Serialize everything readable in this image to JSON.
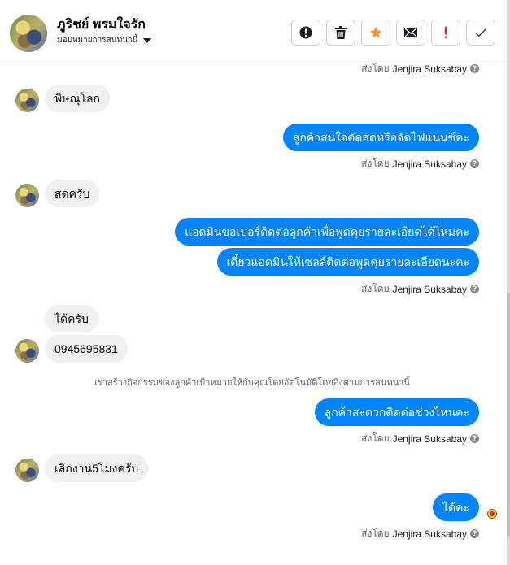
{
  "header": {
    "name": "ภูริชย์ พรมใจรัก",
    "assign_label": "มอบหมายการสนทนานี้",
    "actions": [
      {
        "icon": "alert-circle-icon",
        "color": "#1c1e21"
      },
      {
        "icon": "trash-icon",
        "color": "#1c1e21"
      },
      {
        "icon": "star-icon",
        "color": "#f7923a"
      },
      {
        "icon": "envelope-icon",
        "color": "#1c1e21"
      },
      {
        "icon": "exclamation-icon",
        "color": "#e02424"
      },
      {
        "icon": "check-icon",
        "color": "#4b4f56"
      }
    ]
  },
  "messages": {
    "sent_by_prefix": "ส่งโดย",
    "sent_by_name": "Jenjira Suksabay",
    "m1": "พิษณุโลก",
    "m2": "ลูกค้าสนใจตัดสดหรือจัดไฟแนนซ์คะ",
    "m3": "สดครับ",
    "m4": "แอดมินขอเบอร์ติดต่อลูกค้าเพื่อพูดคุยรายละเอียดได้ไหมคะ",
    "m5": "เดี๋ยวแอดมินให้เซลล์ติดต่อพูดคุยรายละเอียดนะคะ",
    "m6": "ได้ครับ",
    "m7": "0945695831",
    "system": "เราสร้างกิจกรรมของลูกค้าเป้าหมายให้กับคุณโดยอัตโนมัติโดยอิงตามการสนทนานี้",
    "m8": "ลูกค้าสะดวกติดต่อช่วงไหนคะ",
    "m9": "เลิกงาน5โมงครับ",
    "m10": "ได้คะ"
  },
  "colors": {
    "accent": "#0084ff",
    "incoming_bubble": "#f0f0f0"
  }
}
